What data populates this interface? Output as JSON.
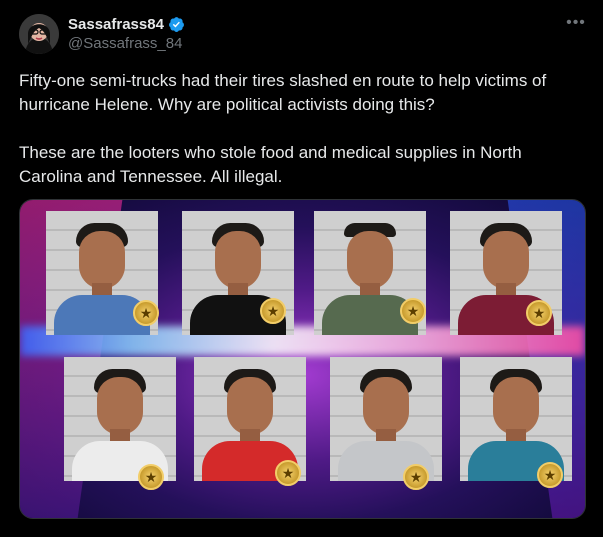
{
  "post": {
    "author": {
      "display_name": "Sassafrass84",
      "handle": "@Sassafrass_84",
      "verified": true,
      "avatar_icon": "avatar-photo"
    },
    "more_icon": "more-horizontal-icon",
    "paragraphs": [
      "Fifty-one semi-trucks had their tires slashed en route to help victims of hurricane Helene. Why are political activists doing this?",
      "These are the looters who stole food and medical supplies in North Carolina and Tennessee. All illegal."
    ],
    "media": {
      "type": "mugshot-collage",
      "count": 8,
      "badge_icon": "sheriff-badge-icon"
    }
  }
}
